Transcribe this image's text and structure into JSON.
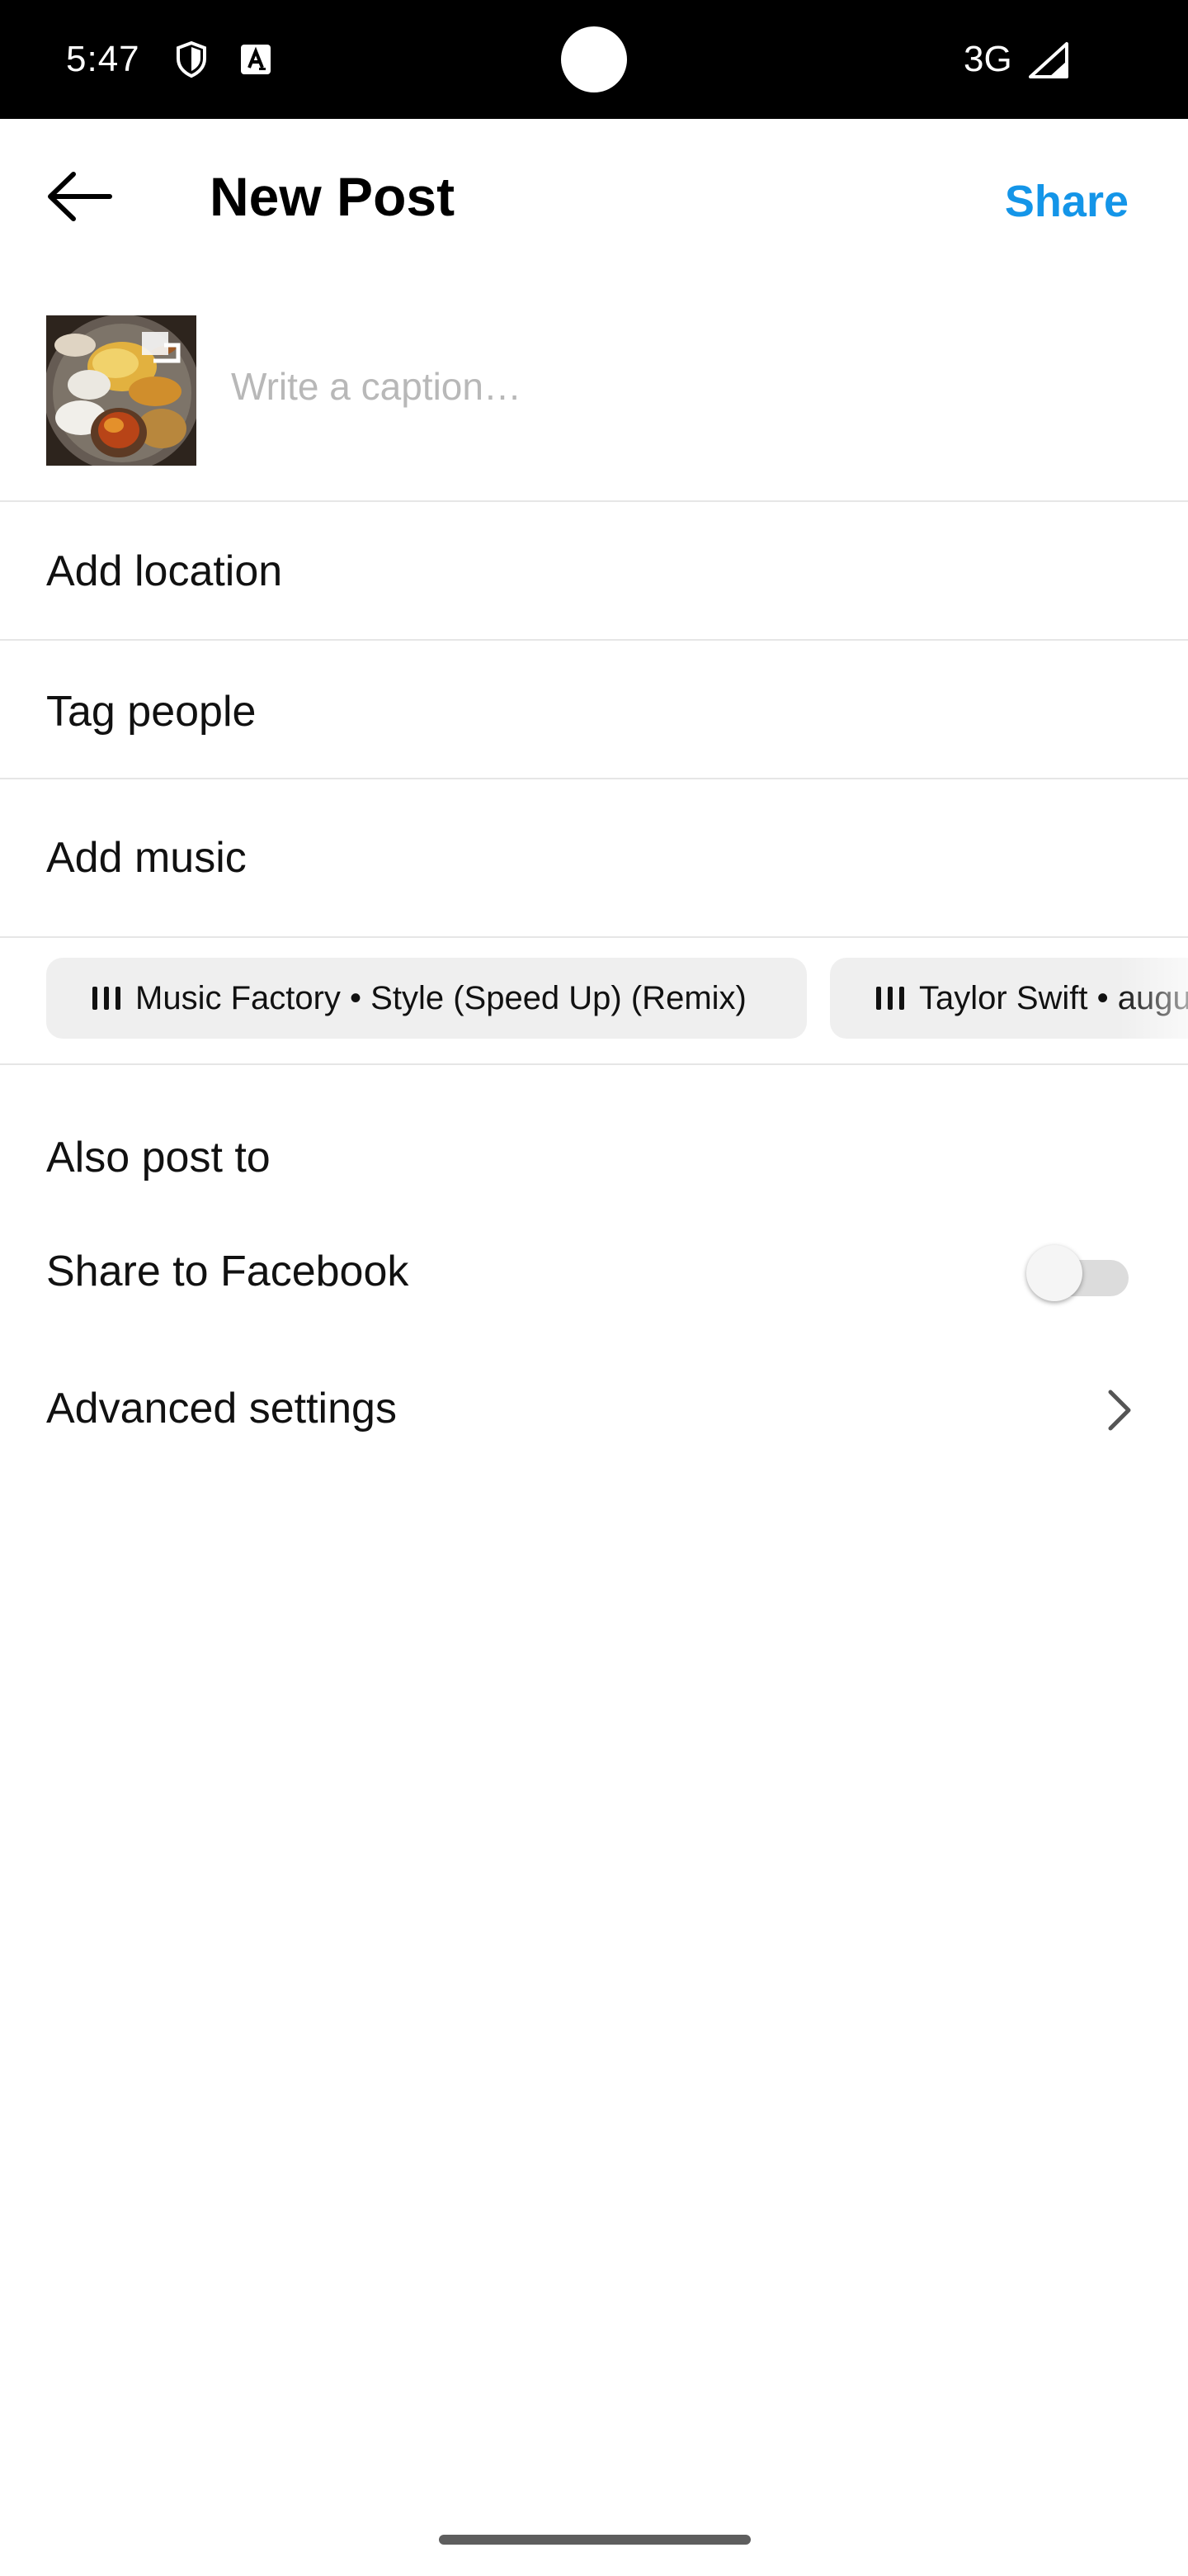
{
  "status_bar": {
    "time": "5:47",
    "network": "3G",
    "icons": [
      "shield-icon",
      "a-box-icon",
      "signal-icon"
    ]
  },
  "header": {
    "title": "New Post",
    "share_label": "Share",
    "back_icon": "arrow-left-icon"
  },
  "caption": {
    "placeholder": "Write a caption…",
    "value": ""
  },
  "options": {
    "add_location": "Add location",
    "tag_people": "Tag people",
    "add_music": "Add music"
  },
  "music_suggestions": [
    {
      "text": "Music Factory • Style (Speed Up) (Remix)"
    },
    {
      "text": "Taylor Swift • august"
    }
  ],
  "also_post_to": {
    "title": "Also post to",
    "facebook_label": "Share to Facebook",
    "facebook_enabled": false
  },
  "advanced": {
    "label": "Advanced settings"
  },
  "colors": {
    "accent": "#1495e8",
    "chip_background": "#efefef",
    "divider": "#e6e6e6"
  }
}
